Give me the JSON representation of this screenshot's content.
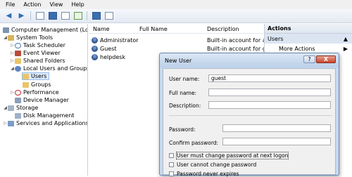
{
  "menu": [
    "File",
    "Action",
    "View",
    "Help"
  ],
  "tree": {
    "root": "Computer Management (Local",
    "system_tools": "System Tools",
    "task_scheduler": "Task Scheduler",
    "event_viewer": "Event Viewer",
    "shared_folders": "Shared Folders",
    "local_users_groups": "Local Users and Groups",
    "users": "Users",
    "groups": "Groups",
    "performance": "Performance",
    "device_manager": "Device Manager",
    "storage": "Storage",
    "disk_management": "Disk Management",
    "services_apps": "Services and Applications"
  },
  "list": {
    "columns": [
      "Name",
      "Full Name",
      "Description"
    ],
    "rows": [
      {
        "name": "Administrator",
        "full_name": "",
        "description": "Built-in account for ad"
      },
      {
        "name": "Guest",
        "full_name": "",
        "description": "Built-in account for gu"
      },
      {
        "name": "helpdesk",
        "full_name": "",
        "description": ""
      }
    ]
  },
  "actions": {
    "header": "Actions",
    "section": "Users",
    "more": "More Actions"
  },
  "dialog": {
    "title": "New User",
    "help_glyph": "?",
    "close_glyph": "X",
    "fields": {
      "user_name_label": "User name:",
      "user_name_value": "guest",
      "full_name_label": "Full name:",
      "full_name_value": "",
      "description_label": "Description:",
      "description_value": "",
      "password_label": "Password:",
      "confirm_label": "Confirm password:"
    },
    "checkboxes": [
      {
        "label": "User must change password at next logon",
        "checked": false
      },
      {
        "label": "User cannot change password",
        "checked": false
      },
      {
        "label": "Password never expires",
        "checked": false
      }
    ]
  },
  "colors": {
    "selection": "#dceafc",
    "dialog_frame": "#c9d9ec",
    "close_button": "#c8442b"
  }
}
